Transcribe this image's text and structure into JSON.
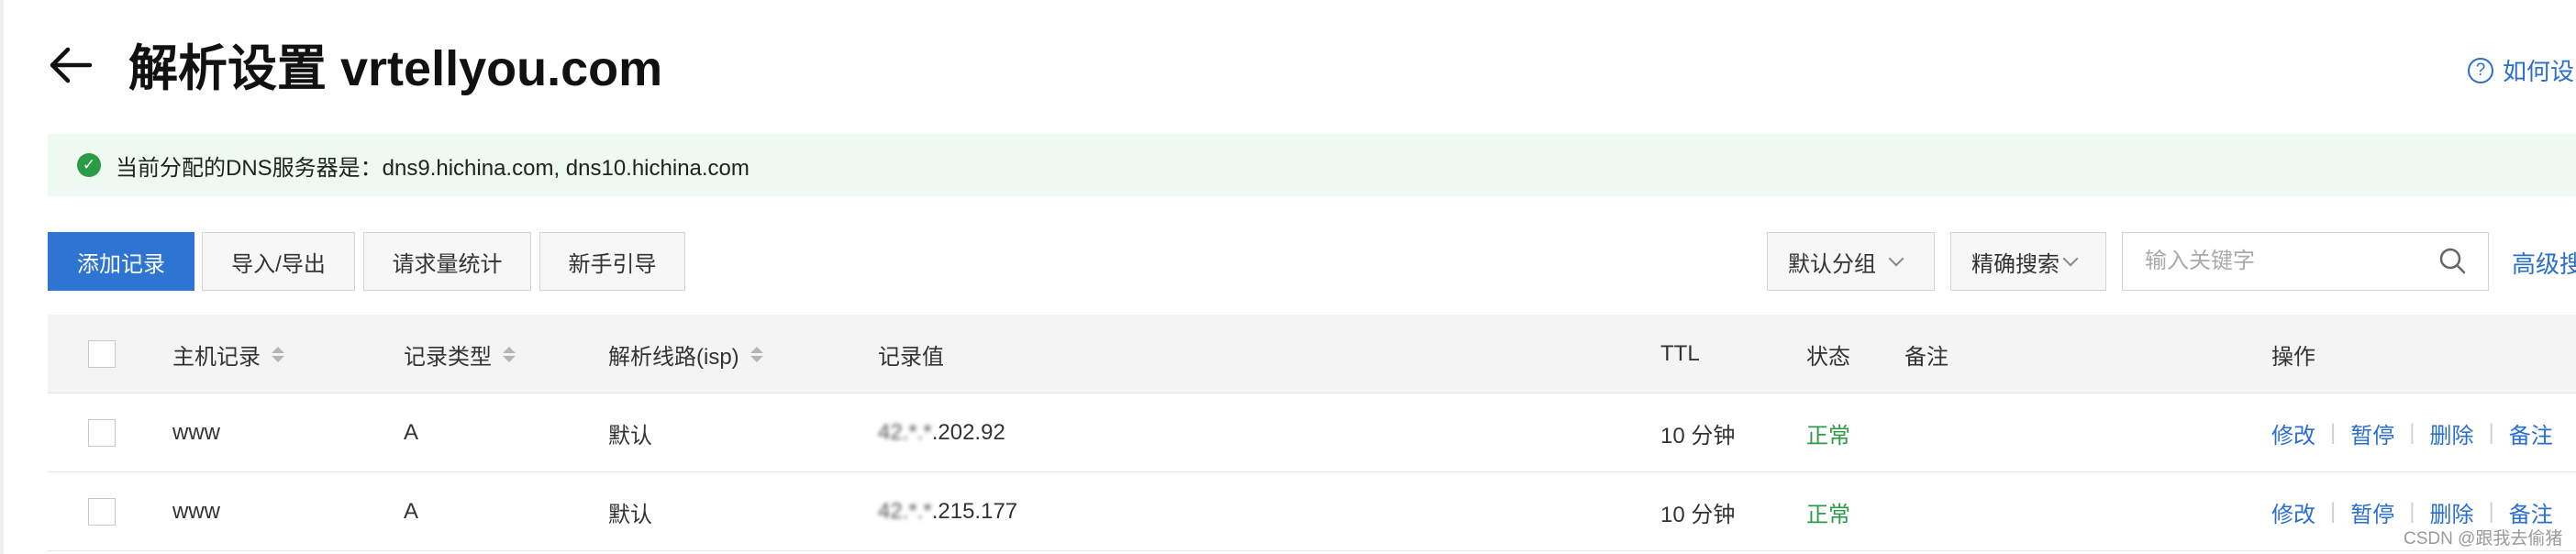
{
  "header": {
    "title": "解析设置 vrtellyou.com",
    "help_label": "如何设"
  },
  "notice": {
    "text": "当前分配的DNS服务器是：dns9.hichina.com, dns10.hichina.com"
  },
  "toolbar": {
    "add_label": "添加记录",
    "import_export_label": "导入/导出",
    "stats_label": "请求量统计",
    "guide_label": "新手引导",
    "group_select": "默认分组",
    "search_mode_select": "精确搜索",
    "search_placeholder": "输入关键字",
    "search_value": "",
    "advanced_label": "高级搜"
  },
  "table": {
    "headers": {
      "host": "主机记录",
      "type": "记录类型",
      "line": "解析线路(isp)",
      "value": "记录值",
      "ttl": "TTL",
      "status": "状态",
      "remark": "备注",
      "actions": "操作"
    },
    "rows": [
      {
        "host": "www",
        "type": "A",
        "line": "默认",
        "value_masked": "42.*.*",
        "value_visible": ".202.92",
        "ttl": "10 分钟",
        "status": "正常",
        "remark": ""
      },
      {
        "host": "www",
        "type": "A",
        "line": "默认",
        "value_masked": "42.*.*",
        "value_visible": ".215.177",
        "ttl": "10 分钟",
        "status": "正常",
        "remark": ""
      }
    ],
    "actions": {
      "edit": "修改",
      "pause": "暂停",
      "delete": "删除",
      "remark": "备注"
    }
  },
  "watermark": "CSDN @跟我去偷猪",
  "colors": {
    "primary": "#2e74d2",
    "link": "#2a6fce",
    "success": "#2c9b46",
    "notice_bg": "#eef9f1",
    "header_bg": "#f4f4f4"
  }
}
